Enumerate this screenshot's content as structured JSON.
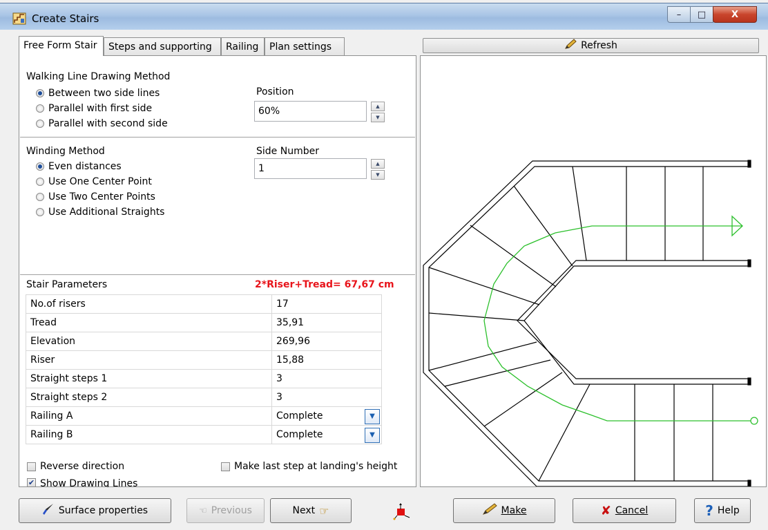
{
  "window": {
    "title": "Create Stairs",
    "caption_buttons": {
      "minimize": "–",
      "maximize": "□",
      "close": "X"
    }
  },
  "tabs": [
    {
      "label": "Free Form Stair",
      "active": true
    },
    {
      "label": "Steps and supporting",
      "active": false
    },
    {
      "label": "Railing",
      "active": false
    },
    {
      "label": "Plan settings",
      "active": false
    }
  ],
  "walking_line": {
    "title": "Walking Line Drawing Method",
    "options": [
      {
        "label": "Between two side lines",
        "selected": true
      },
      {
        "label": "Parallel with first side",
        "selected": false
      },
      {
        "label": "Parallel with second side",
        "selected": false
      }
    ],
    "position_label": "Position",
    "position_value": "60%"
  },
  "winding": {
    "title": "Winding Method",
    "options": [
      {
        "label": "Even distances",
        "selected": true
      },
      {
        "label": "Use One Center Point",
        "selected": false
      },
      {
        "label": "Use Two Center Points",
        "selected": false
      },
      {
        "label": "Use Additional Straights",
        "selected": false
      }
    ],
    "side_number_label": "Side Number",
    "side_number_value": "1"
  },
  "stair_parameters": {
    "title": "Stair Parameters",
    "formula": "2*Riser+Tread= 67,67 cm",
    "formula_color": "#e8141b",
    "rows": [
      {
        "label": "No.of risers",
        "value": "17"
      },
      {
        "label": "Tread",
        "value": "35,91"
      },
      {
        "label": "Elevation",
        "value": "269,96"
      },
      {
        "label": "Riser",
        "value": "15,88"
      },
      {
        "label": "Straight steps 1",
        "value": "3"
      },
      {
        "label": "Straight steps 2",
        "value": "3"
      },
      {
        "label": "Railing A",
        "value": "Complete"
      },
      {
        "label": "Railing B",
        "value": "Complete"
      }
    ]
  },
  "checkboxes": {
    "reverse_direction": {
      "label": "Reverse direction",
      "checked": false
    },
    "make_last_step": {
      "label": "Make last step at landing's height",
      "checked": false
    },
    "show_drawing_lines": {
      "label": "Show Drawing Lines",
      "checked": true
    }
  },
  "refresh_label": "Refresh",
  "buttons": {
    "surface_properties": "Surface properties",
    "previous": "Previous",
    "next": "Next",
    "make": "Make",
    "cancel": "Cancel",
    "help": "Help"
  },
  "colors": {
    "walking_line": "#2cc02c",
    "formula_red": "#e8141b",
    "help_blue": "#1c5fb8",
    "cancel_red": "#c81010"
  }
}
